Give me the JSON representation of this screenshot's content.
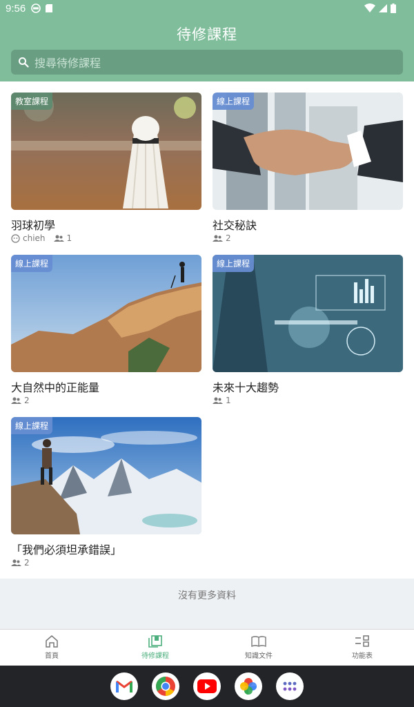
{
  "status": {
    "time": "9:56"
  },
  "header": {
    "title": "待修課程",
    "search_placeholder": "搜尋待修課程"
  },
  "courses": [
    {
      "badge": "教室課程",
      "title": "羽球初學",
      "author": "chieh",
      "members": "1"
    },
    {
      "badge": "線上課程",
      "title": "社交秘訣",
      "members": "2"
    },
    {
      "badge": "線上課程",
      "title": "大自然中的正能量",
      "members": "2"
    },
    {
      "badge": "線上課程",
      "title": "未來十大趨勢",
      "members": "1"
    },
    {
      "badge": "線上課程",
      "title": "「我們必須坦承錯誤」",
      "members": "2"
    }
  ],
  "no_more": "沒有更多資料",
  "nav": {
    "home": "首頁",
    "pending": "待修課程",
    "docs": "知識文件",
    "menu": "功能表"
  },
  "dock_apps": [
    "gmail-icon",
    "chrome-icon",
    "youtube-icon",
    "photos-icon",
    "app-drawer-icon"
  ],
  "colors": {
    "primary": "#7fbd9b",
    "active": "#4caf7d",
    "badge_online": "#668dd2",
    "badge_classroom": "#5c8c70"
  }
}
